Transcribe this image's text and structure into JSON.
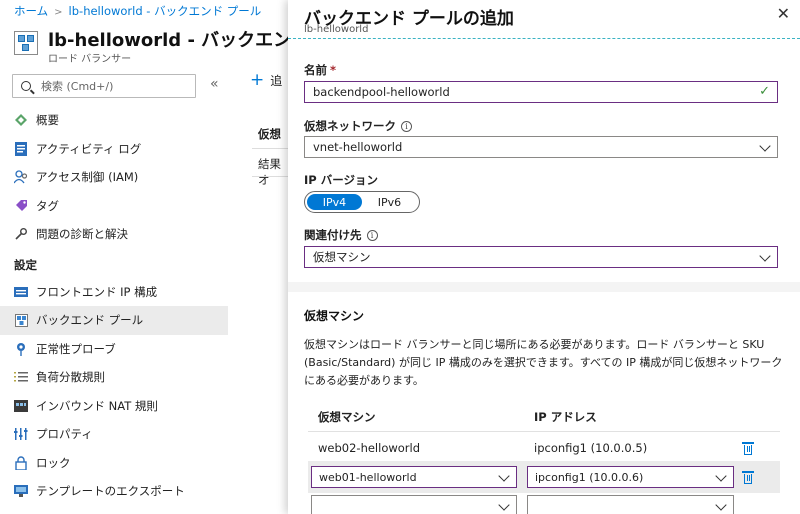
{
  "breadcrumb": {
    "home": "ホーム",
    "item": "lb-helloworld - バックエンド プール"
  },
  "resource": {
    "title": "lb-helloworld - バックエンド プー",
    "subtitle": "ロード バランサー"
  },
  "search": {
    "placeholder": "検索 (Cmd+/)"
  },
  "collapse_glyph": "«",
  "menu_top": [
    {
      "label": "概要",
      "icon": "overview-icon"
    },
    {
      "label": "アクティビティ ログ",
      "icon": "activity-log-icon"
    },
    {
      "label": "アクセス制御 (IAM)",
      "icon": "access-control-icon"
    },
    {
      "label": "タグ",
      "icon": "tag-icon"
    },
    {
      "label": "問題の診断と解決",
      "icon": "wrench-icon"
    }
  ],
  "settings_header": "設定",
  "menu_settings": [
    {
      "label": "フロントエンド IP 構成",
      "icon": "frontend-ip-icon"
    },
    {
      "label": "バックエンド プール",
      "icon": "backend-pool-icon",
      "selected": true
    },
    {
      "label": "正常性プローブ",
      "icon": "health-probe-icon"
    },
    {
      "label": "負荷分散規則",
      "icon": "lb-rules-icon"
    },
    {
      "label": "インバウンド NAT 規則",
      "icon": "nat-rules-icon"
    },
    {
      "label": "プロパティ",
      "icon": "properties-icon"
    },
    {
      "label": "ロック",
      "icon": "lock-icon"
    },
    {
      "label": "テンプレートのエクスポート",
      "icon": "export-template-icon"
    }
  ],
  "main_bg": {
    "add_label": "追",
    "header_fragment": "仮想",
    "row_fragment": "結果オ"
  },
  "panel": {
    "title": "バックエンド プールの追加",
    "subtitle": "lb-helloworld",
    "close_glyph": "✕",
    "name_label": "名前",
    "name_required": "*",
    "name_value": "backendpool-helloworld",
    "vnet_label": "仮想ネットワーク",
    "vnet_value": "vnet-helloworld",
    "ipver_label": "IP バージョン",
    "ipver_options": [
      "IPv4",
      "IPv6"
    ],
    "ipver_selected": "IPv4",
    "assoc_label": "関連付け先",
    "assoc_value": "仮想マシン",
    "vm_section_title": "仮想マシン",
    "vm_description": "仮想マシンはロード バランサーと同じ場所にある必要があります。ロード バランサーと SKU (Basic/Standard) が同じ IP 構成のみを選択できます。すべての IP 構成が同じ仮想ネットワークにある必要があります。",
    "table_headers": [
      "仮想マシン",
      "IP アドレス"
    ],
    "rows": [
      {
        "vm": "web02-helloworld",
        "ip": "ipconfig1 (10.0.0.5)"
      },
      {
        "vm": "web01-helloworld",
        "ip": "ipconfig1 (10.0.0.6)"
      },
      {
        "vm": "",
        "ip": ""
      }
    ]
  },
  "colors": {
    "accent": "#0078d4",
    "focus_border": "#6a2e82",
    "valid": "#3b8f3b",
    "selected_bg": "#ebebeb"
  }
}
